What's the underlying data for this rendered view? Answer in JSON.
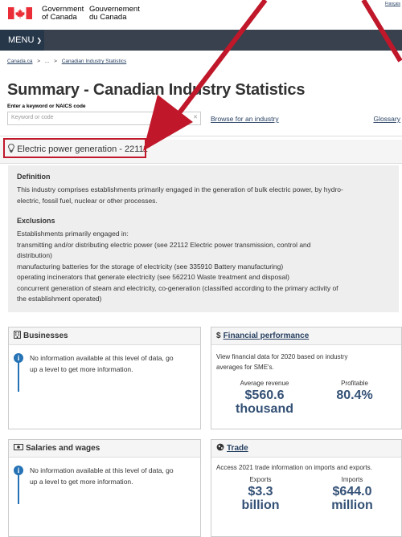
{
  "header": {
    "gov_en_line1": "Government",
    "gov_en_line2": "of Canada",
    "gov_fr_line1": "Gouvernement",
    "gov_fr_line2": "du Canada",
    "lang_link": "Français",
    "menu_label": "MENU"
  },
  "breadcrumb": {
    "home": "Canada.ca",
    "sep": ">",
    "ellipsis": "...",
    "current": "Canadian Industry Statistics"
  },
  "page_title": "Summary - Canadian Industry Statistics",
  "search": {
    "label": "Enter a keyword or NAICS code",
    "placeholder": "Keyword or code",
    "browse_link": "Browse for an industry",
    "glossary_link": "Glossary"
  },
  "industry": {
    "title": "Electric power generation - 22111"
  },
  "definition": {
    "heading": "Definition",
    "text_line1": "This industry comprises establishments primarily engaged in the generation of bulk electric power, by hydro-",
    "text_line2": "electric, fossil fuel, nuclear or other processes.",
    "exclusions_heading": "Exclusions",
    "ex_lines": [
      "Establishments primarily engaged in:",
      "transmitting and/or distributing electric power (see 22112 Electric power transmission, control and",
      "distribution)",
      "manufacturing batteries for the storage of electricity (see 335910 Battery manufacturing)",
      "operating incinerators that generate electricity (see 562210 Waste treatment and disposal)",
      "concurrent generation of steam and electricity, co-generation (classified according to the primary activity of",
      "the establishment operated)"
    ]
  },
  "businesses": {
    "heading": "Businesses",
    "no_info_line1": "No information available at this level of data, go",
    "no_info_line2": "up a level to get more information."
  },
  "financial": {
    "heading": "Financial performance",
    "desc_line1": "View financial data for 2020 based on industry",
    "desc_line2": "averages for SME's.",
    "avg_rev_label": "Average revenue",
    "avg_rev_value1": "$560.6",
    "avg_rev_value2": "thousand",
    "profitable_label": "Profitable",
    "profitable_value": "80.4%"
  },
  "salaries": {
    "heading": "Salaries and wages",
    "no_info_line1": "No information available at this level of data, go",
    "no_info_line2": "up a level to get more information."
  },
  "trade": {
    "heading": "Trade",
    "desc": "Access 2021 trade information on imports and exports.",
    "exports_label": "Exports",
    "exports_value1": "$3.3",
    "exports_value2": "billion",
    "imports_label": "Imports",
    "imports_value1": "$644.0",
    "imports_value2": "million"
  },
  "colors": {
    "menu_bar": "#38414d",
    "menu_button": "#26374a",
    "link": "#284162",
    "highlight_box": "#c0182a",
    "arrow": "#c0182a",
    "stat_value": "#335075",
    "info_icon": "#2572b4"
  },
  "icons": {
    "flag": "canada-flag-icon",
    "bulb": "lightbulb-icon",
    "businesses": "building-icon",
    "financial": "dollar-icon",
    "salaries": "money-icon",
    "trade": "globe-icon",
    "info": "info-icon"
  }
}
